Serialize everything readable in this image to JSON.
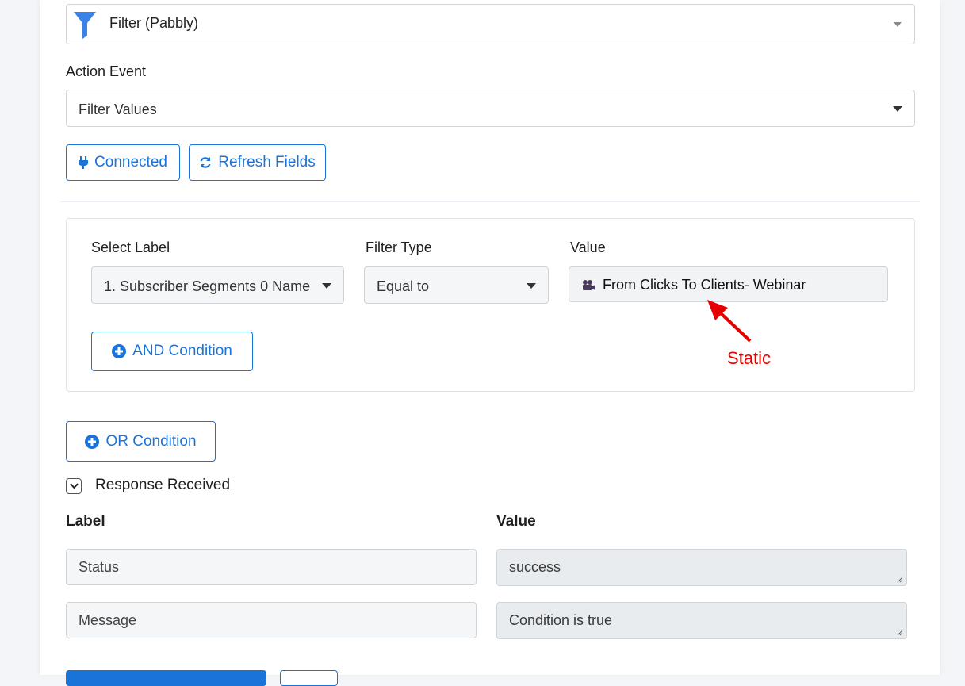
{
  "app": {
    "name": "Filter (Pabbly)"
  },
  "action_event": {
    "label": "Action Event",
    "value": "Filter Values"
  },
  "buttons": {
    "connected": "Connected",
    "refresh": "Refresh Fields",
    "and_condition": "AND Condition",
    "or_condition": "OR Condition"
  },
  "filter": {
    "select_label_heading": "Select Label",
    "filter_type_heading": "Filter Type",
    "value_heading": "Value",
    "select_label_value": "1. Subscriber Segments 0 Name",
    "filter_type_value": "Equal to",
    "value": "From Clicks To Clients- Webinar"
  },
  "annotation": {
    "text": "Static",
    "color": "#e60000"
  },
  "response": {
    "title": "Response Received",
    "label_heading": "Label",
    "value_heading": "Value",
    "rows": [
      {
        "label": "Status",
        "value": "success"
      },
      {
        "label": "Message",
        "value": "Condition is true"
      }
    ]
  },
  "colors": {
    "accent": "#1a73d9",
    "funnel": "#3b82e8"
  }
}
